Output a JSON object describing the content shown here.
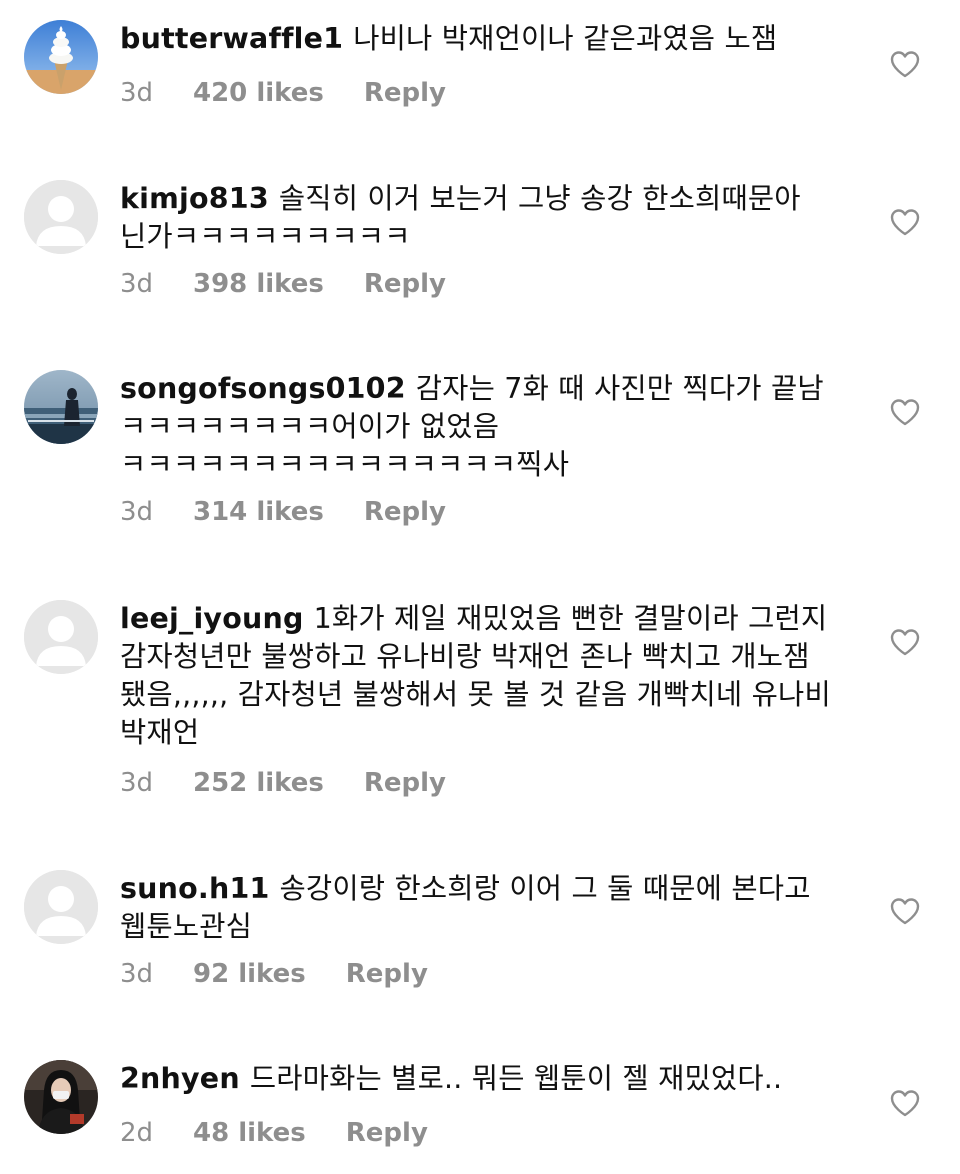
{
  "comments": [
    {
      "username": "butterwaffle1",
      "text": "나비나 박재언이나 같은과였음 노잼",
      "time": "3d",
      "likes": "420 likes",
      "reply": "Reply",
      "avatar": "soft-serve-icecream-photo"
    },
    {
      "username": "kimjo813",
      "text": "솔직히 이거 보는거 그냥 송강 한소희때문아 닌가ㅋㅋㅋㅋㅋㅋㅋㅋㅋ",
      "time": "3d",
      "likes": "398 likes",
      "reply": "Reply",
      "avatar": "default-user-icon"
    },
    {
      "username": "songofsongs0102",
      "text": "감자는 7화 때 사진만 찍다가 끝남 ㅋㅋㅋㅋㅋㅋㅋㅋ어이가 없었음 ㅋㅋㅋㅋㅋㅋㅋㅋㅋㅋㅋㅋㅋㅋㅋ찍사",
      "time": "3d",
      "likes": "314 likes",
      "reply": "Reply",
      "avatar": "seaside-person-photo"
    },
    {
      "username": "leej_iyoung",
      "text": "1화가 제일 재밌었음 뻔한 결말이라 그런지 감자청년만 불쌍하고 유나비랑 박재언 존나 빡치고 개노잼 됐음,,,,,, 감자청년 불쌍해서 못 볼 것 같음 개빡치네 유나비 박재언",
      "time": "3d",
      "likes": "252 likes",
      "reply": "Reply",
      "avatar": "default-user-icon"
    },
    {
      "username": "suno.h11",
      "text": "송강이랑 한소희랑 이어 그 둘 때문에 본다고 웹툰노관심",
      "time": "3d",
      "likes": "92 likes",
      "reply": "Reply",
      "avatar": "default-user-icon"
    },
    {
      "username": "2nhyen",
      "text": "드라마화는 별로.. 뭐든 웹툰이 젤 재밌었다..",
      "time": "2d",
      "likes": "48 likes",
      "reply": "Reply",
      "avatar": "person-in-dark-photo"
    }
  ],
  "colors": {
    "text": "#111111",
    "meta": "#8e8e8e",
    "heart_stroke": "#8e8e8e",
    "avatar_placeholder": "#e6e6e6"
  },
  "icons": {
    "like": "heart-outline-icon"
  }
}
